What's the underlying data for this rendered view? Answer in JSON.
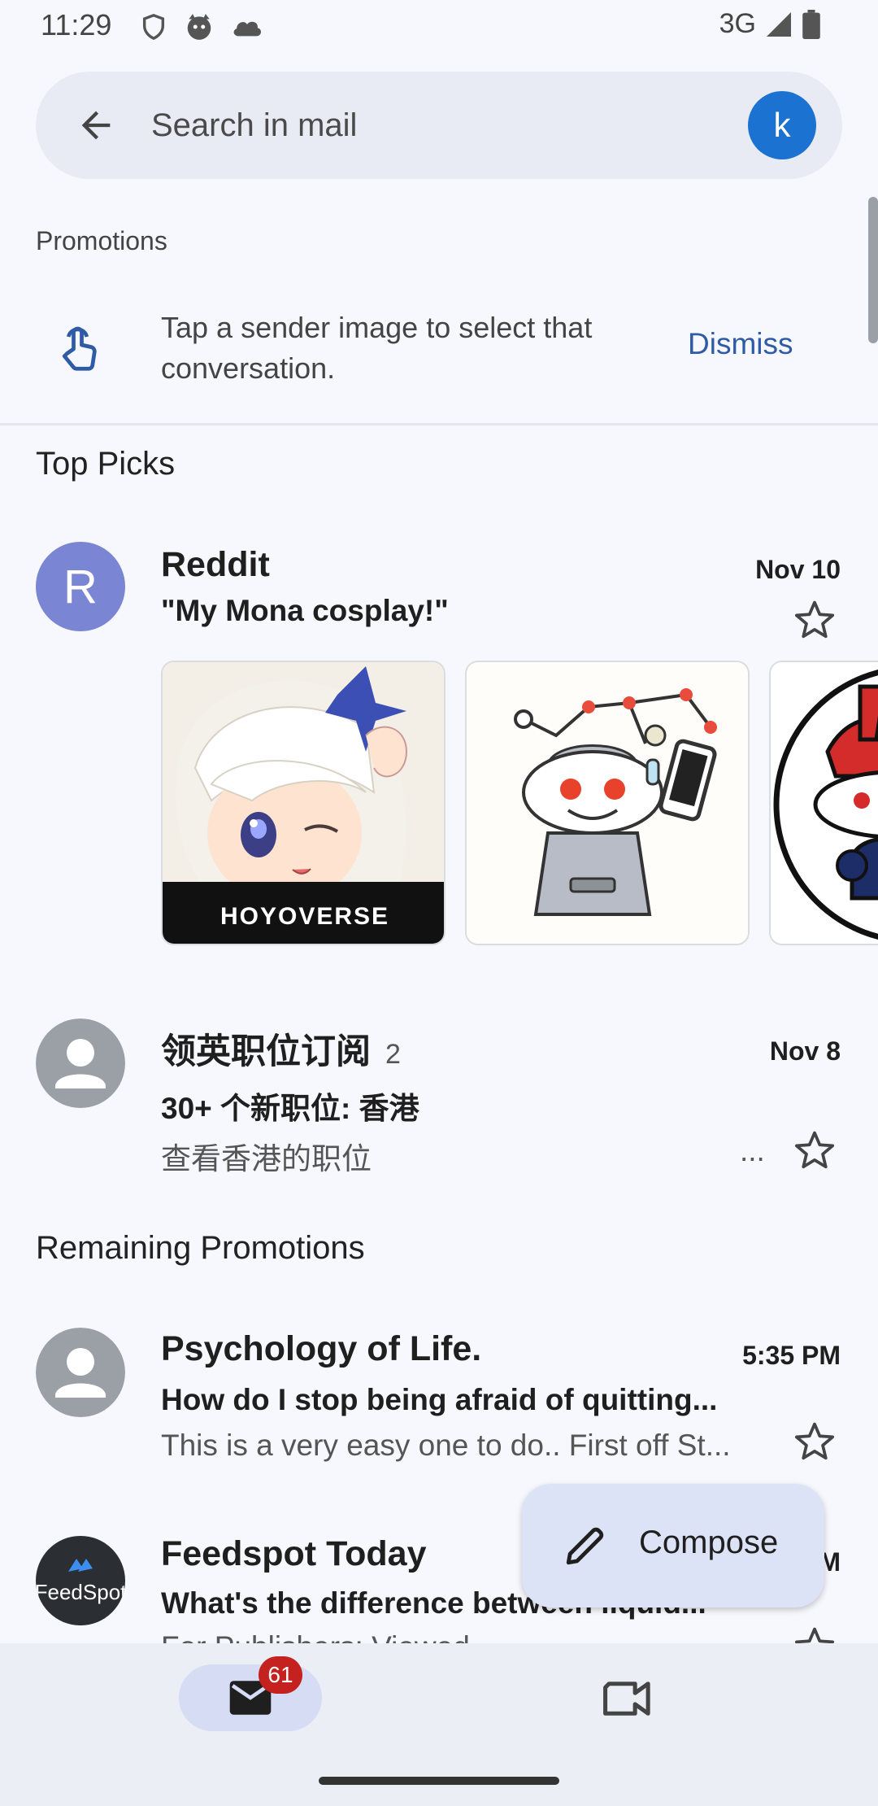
{
  "status_bar": {
    "time": "11:29",
    "network": "3G",
    "icons": [
      "shield-icon",
      "cat-face-icon",
      "cloud-icon",
      "signal-icon",
      "battery-icon"
    ]
  },
  "search": {
    "placeholder": "Search in mail",
    "account_initial": "k",
    "account_color": "#1b72d1"
  },
  "mailbox_label": "Promotions",
  "tip": {
    "text": "Tap a sender image to select that conversation.",
    "dismiss_label": "Dismiss",
    "icon": "tap-gesture-icon"
  },
  "top_picks": {
    "heading": "Top Picks",
    "emails": [
      {
        "avatar_letter": "R",
        "avatar_color": "#7a86d4",
        "sender": "Reddit",
        "date": "Nov 10",
        "subject": "\"My Mona cosplay!\"",
        "attachments": [
          {
            "label": "HOYOVERSE",
            "kind": "anime-character-image"
          },
          {
            "kind": "reddit-detective-mascot-image"
          },
          {
            "kind": "reddit-mascot-image"
          }
        ]
      },
      {
        "sender": "领英职位订阅",
        "thread_count": "2",
        "date": "Nov 8",
        "subject": "30+ 个新职位: 香港",
        "snippet": "查看香港的职位",
        "extra": "..."
      }
    ]
  },
  "remaining": {
    "heading": "Remaining Promotions",
    "emails": [
      {
        "sender": "Psychology of Life.",
        "date": "5:35 PM",
        "subject": "How do I stop being afraid of quitting...",
        "snippet": "This is a very easy one to do.. First off St..."
      },
      {
        "sender": "Feedspot Today",
        "avatar_text": "FeedSpot",
        "date_partial": "M",
        "subject": "What's the difference between liquid...",
        "snippet": "For Publishers: Viewed..."
      }
    ]
  },
  "compose": {
    "label": "Compose"
  },
  "bottom_nav": {
    "mail_badge": "61"
  },
  "colors": {
    "background": "#f7f8fd",
    "accent_link": "#2f5ba6",
    "badge": "#c5221f",
    "compose_bg": "#dde3f6"
  }
}
